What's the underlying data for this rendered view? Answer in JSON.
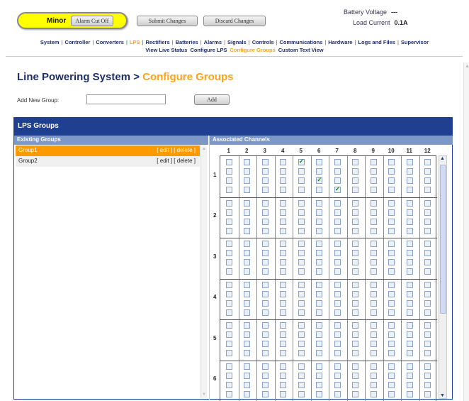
{
  "header": {
    "alarm_severity": "Minor",
    "alarm_color": "#ffff00",
    "alarm_cut_off_label": "Alarm Cut Off",
    "submit_label": "Submit Changes",
    "discard_label": "Discard Changes",
    "battery_voltage_label": "Battery Voltage",
    "battery_voltage_value": "---",
    "load_current_label": "Load Current",
    "load_current_value": "0.1A"
  },
  "nav": {
    "items": [
      "System",
      "Controller",
      "Converters",
      "LPS",
      "Rectifiers",
      "Batteries",
      "Alarms",
      "Signals",
      "Controls",
      "Communications",
      "Hardware",
      "Logs and Files",
      "Supervisor"
    ],
    "active": "LPS",
    "subitems": [
      "View Live Status",
      "Configure LPS",
      "Configure Groups",
      "Custom Text View"
    ],
    "active_sub": "Configure Groups",
    "active_color": "#ffa31a"
  },
  "page": {
    "title_main": "Line Powering System > ",
    "title_sub": "Configure Groups",
    "add_group_label": "Add New Group:",
    "add_group_value": "",
    "add_button": "Add"
  },
  "panel": {
    "title": "LPS Groups",
    "existing_header": "Existing Groups",
    "channels_header": "Associated Channels",
    "groups": [
      {
        "name": "Group1",
        "actions": "[ edit ] [ delete ]",
        "selected": true
      },
      {
        "name": "Group2",
        "actions": "[ edit ] [ delete ]",
        "selected": false
      }
    ],
    "channel_columns": [
      "1",
      "2",
      "3",
      "4",
      "5",
      "6",
      "7",
      "8",
      "9",
      "10",
      "11",
      "12"
    ],
    "channel_rows": [
      "1",
      "2",
      "3",
      "4",
      "5",
      "6"
    ],
    "checkboxes_per_cell": 4,
    "checked": [
      {
        "row": "1",
        "col": "5",
        "slot": 1
      },
      {
        "row": "1",
        "col": "6",
        "slot": 3
      },
      {
        "row": "1",
        "col": "7",
        "slot": 4
      }
    ]
  }
}
